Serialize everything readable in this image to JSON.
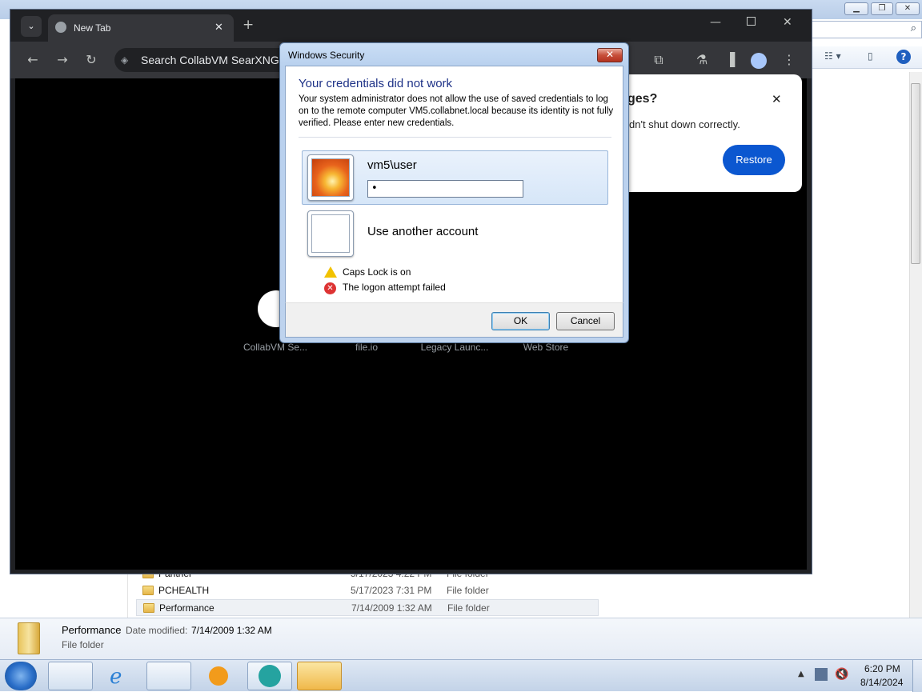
{
  "browser": {
    "tab_title": "New Tab",
    "omnibox_text": "Search CollabVM SearXNG o",
    "shortcuts": [
      "CollabVM Se...",
      "file.io",
      "Legacy Launc...",
      "Web Store"
    ],
    "restore_popup": {
      "title_fragment": "ges?",
      "message_fragment": "dn't shut down correctly.",
      "restore_label": "Restore"
    }
  },
  "dialog": {
    "window_title": "Windows Security",
    "heading": "Your credentials did not work",
    "message": "Your system administrator does not allow the use of saved credentials to log on to the remote computer VM5.collabnet.local because its identity is not fully verified. Please enter new credentials.",
    "account_name": "vm5\\user",
    "password_value": "•",
    "other_account_label": "Use another account",
    "status": [
      "Caps Lock is on",
      "The logon attempt failed"
    ],
    "ok_label": "OK",
    "cancel_label": "Cancel"
  },
  "explorer": {
    "files": [
      {
        "name": "Panther",
        "date": "5/17/2023 4:22 PM",
        "type": "File folder"
      },
      {
        "name": "PCHEALTH",
        "date": "5/17/2023 7:31 PM",
        "type": "File folder"
      },
      {
        "name": "Performance",
        "date": "7/14/2009 1:32 AM",
        "type": "File folder"
      }
    ],
    "details": {
      "name": "Performance",
      "date_label": "Date modified:",
      "date_value": "7/14/2009 1:32 AM",
      "type": "File folder"
    }
  },
  "taskbar": {
    "time": "6:20 PM",
    "date": "8/14/2024"
  }
}
